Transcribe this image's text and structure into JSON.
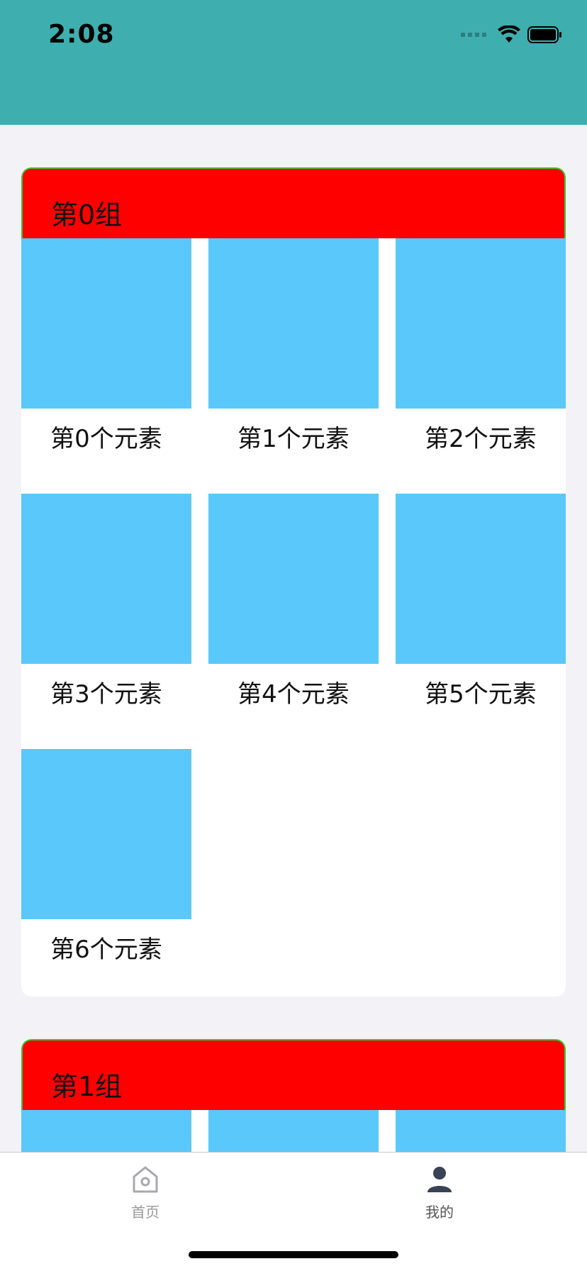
{
  "status": {
    "time": "2:08"
  },
  "groups": [
    {
      "title": "第0组",
      "items": [
        {
          "label": "第0个元素"
        },
        {
          "label": "第1个元素"
        },
        {
          "label": "第2个元素"
        },
        {
          "label": "第3个元素"
        },
        {
          "label": "第4个元素"
        },
        {
          "label": "第5个元素"
        },
        {
          "label": "第6个元素"
        }
      ]
    },
    {
      "title": "第1组"
    }
  ],
  "tabbar": {
    "items": [
      {
        "label": "首页",
        "icon": "home-icon",
        "selected": false
      },
      {
        "label": "我的",
        "icon": "person-icon",
        "selected": true
      }
    ]
  },
  "colors": {
    "nav_background": "#3FAEAF",
    "group_header": "#FF0000",
    "group_header_border": "#33CC33",
    "cell_image": "#5AC8FA",
    "page_background": "#F2F2F7"
  }
}
